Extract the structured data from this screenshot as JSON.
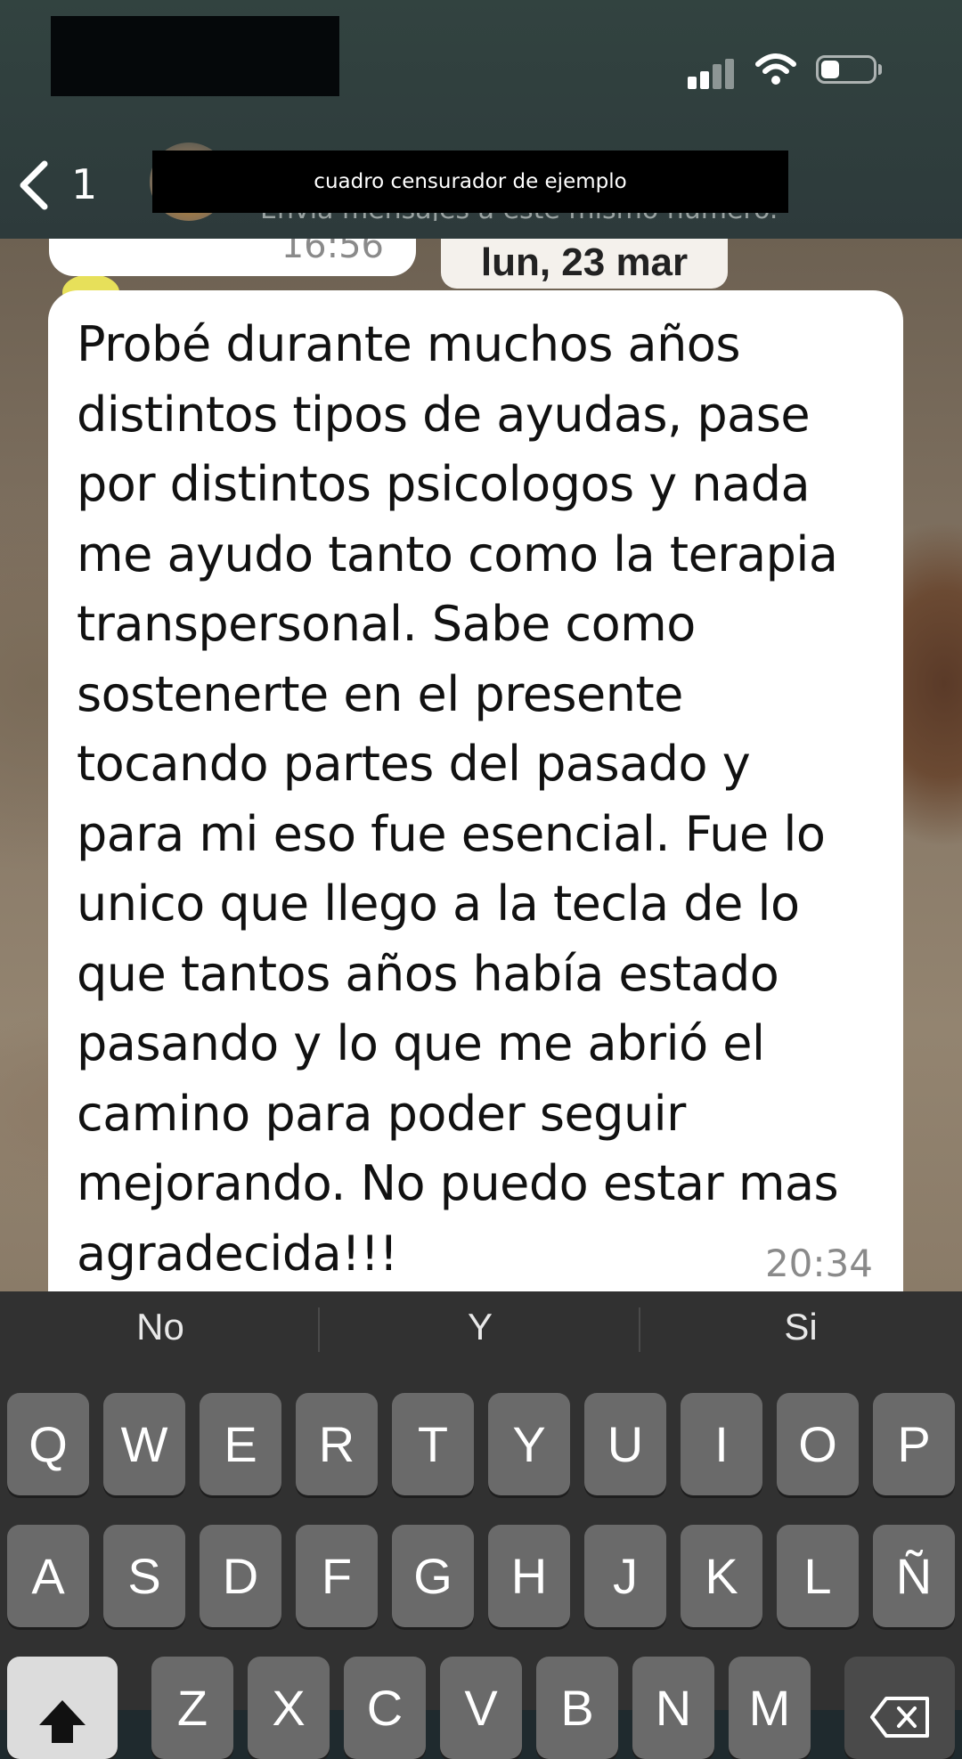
{
  "header": {
    "back_count": "1",
    "subtitle_partial": "Envía mensajes a este mismo número.",
    "censor_label": "cuadro censurador de ejemplo"
  },
  "chat": {
    "prev_message_time": "16:56",
    "date_chip": "lun, 23 mar",
    "message_text": "Probé durante muchos años\ndistintos tipos de ayudas, pase\npor distintos psicologos y nada\nme ayudo tanto como la terapia\ntranspersonal. Sabe como\nsostenerte en el presente\ntocando partes del pasado y\npara mi eso fue esencial. Fue lo\nunico que llego a la tecla de lo\nque tantos años había estado\npasando y lo que me abrió el\ncamino para poder seguir\nmejorando. No puedo estar mas\nagradecida!!!",
    "message_time": "20:34"
  },
  "keyboard": {
    "suggestions": [
      "No",
      "Y",
      "Si"
    ],
    "row1": [
      "Q",
      "W",
      "E",
      "R",
      "T",
      "Y",
      "U",
      "I",
      "O",
      "P"
    ],
    "row2": [
      "A",
      "S",
      "D",
      "F",
      "G",
      "H",
      "J",
      "K",
      "L",
      "Ñ"
    ],
    "row3": [
      "Z",
      "X",
      "C",
      "V",
      "B",
      "N",
      "M"
    ]
  },
  "icons": {
    "signal": "signal-icon",
    "wifi": "wifi-icon",
    "battery": "battery-icon",
    "back": "chevron-left-icon",
    "shift": "shift-icon",
    "delete": "delete-icon"
  }
}
